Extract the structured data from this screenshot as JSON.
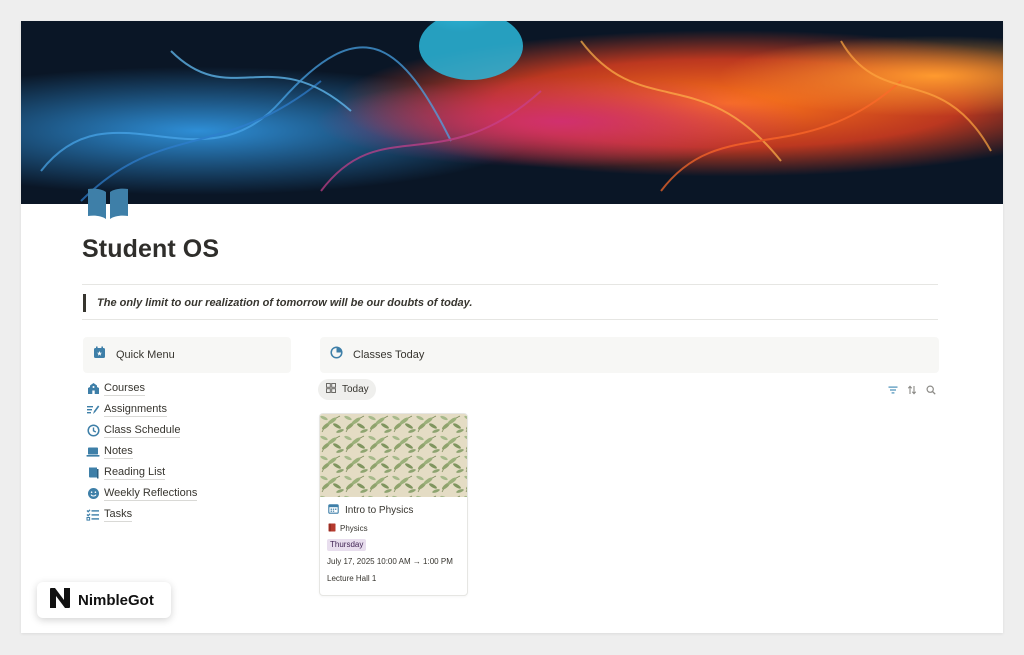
{
  "page": {
    "title": "Student OS",
    "quote": "The only limit to our realization of tomorrow will be our doubts of today."
  },
  "quick_menu": {
    "title": "Quick Menu",
    "items": [
      {
        "label": "Courses",
        "icon": "school-icon"
      },
      {
        "label": "Assignments",
        "icon": "list-pen-icon"
      },
      {
        "label": "Class Schedule",
        "icon": "clock-icon"
      },
      {
        "label": "Notes",
        "icon": "laptop-icon"
      },
      {
        "label": "Reading List",
        "icon": "book-icon"
      },
      {
        "label": "Weekly Reflections",
        "icon": "smiley-icon"
      },
      {
        "label": "Tasks",
        "icon": "checklist-icon"
      }
    ]
  },
  "classes_today": {
    "title": "Classes Today",
    "view_tab": "Today",
    "toolbar_icons": [
      "filter-icon",
      "sort-icon",
      "search-icon"
    ],
    "card": {
      "title": "Intro to Physics",
      "course": "Physics",
      "day": "Thursday",
      "datetime": "July 17, 2025 10:00 AM → 1:00 PM",
      "location": "Lecture Hall 1"
    }
  },
  "brand": {
    "name": "NimbleGot",
    "logo_letter": "N"
  },
  "colors": {
    "accent_blue": "#3e7fa8",
    "text": "#37352f",
    "tag_purple_bg": "#e8deee"
  }
}
